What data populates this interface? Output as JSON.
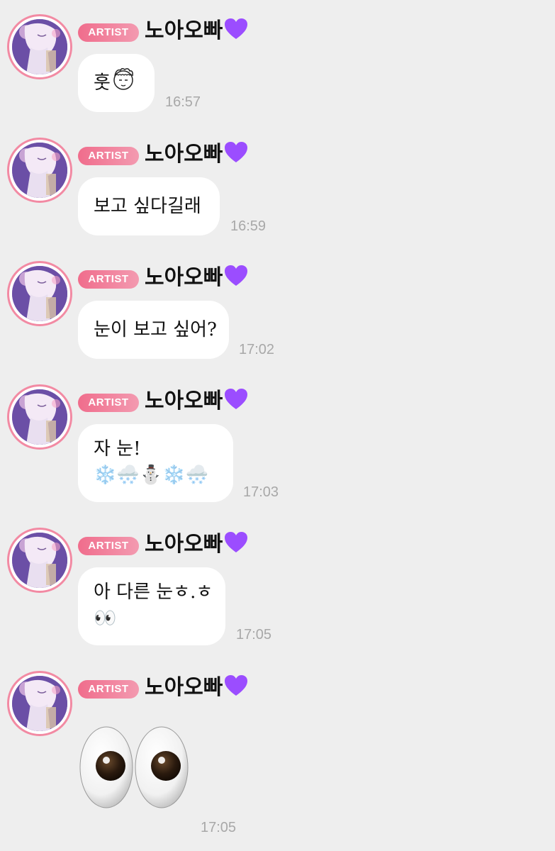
{
  "sender": {
    "badge": "ARTIST",
    "name": "노아오빠",
    "heart_color": "#9b4dff"
  },
  "messages": [
    {
      "lines": [
        "훗"
      ],
      "icon": "doodle-face-icon",
      "time": "16:57"
    },
    {
      "lines": [
        "보고 싶다길래"
      ],
      "time": "16:59"
    },
    {
      "lines": [
        "눈이 보고 싶어?"
      ],
      "time": "17:02"
    },
    {
      "lines": [
        "자 눈!",
        "❄️🌨️⛄❄️🌨️"
      ],
      "time": "17:03"
    },
    {
      "lines": [
        "아 다른 눈ㅎ.ㅎ",
        "👀"
      ],
      "time": "17:05"
    },
    {
      "lines": [],
      "sticker": "big-eyes-emoji",
      "time": "17:05"
    }
  ],
  "colors": {
    "background": "#eeeeee",
    "bubble": "#ffffff",
    "badge_gradient_start": "#f06d8c",
    "badge_gradient_end": "#f39ab0",
    "avatar_ring": "#f28aa3",
    "timestamp": "#a8a8a8"
  }
}
